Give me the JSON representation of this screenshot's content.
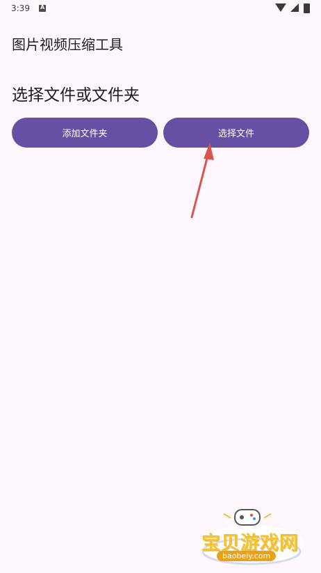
{
  "status_bar": {
    "time": "3:39"
  },
  "app": {
    "title": "图片视频压缩工具"
  },
  "main": {
    "heading": "选择文件或文件夹",
    "buttons": {
      "add_folder": "添加文件夹",
      "select_file": "选择文件"
    }
  },
  "watermark": {
    "name": "宝贝游戏网",
    "domain": "baobeiy.com"
  },
  "colors": {
    "background": "#fdf7fd",
    "button": "#6750a4",
    "annotation_arrow": "#d9534f"
  }
}
